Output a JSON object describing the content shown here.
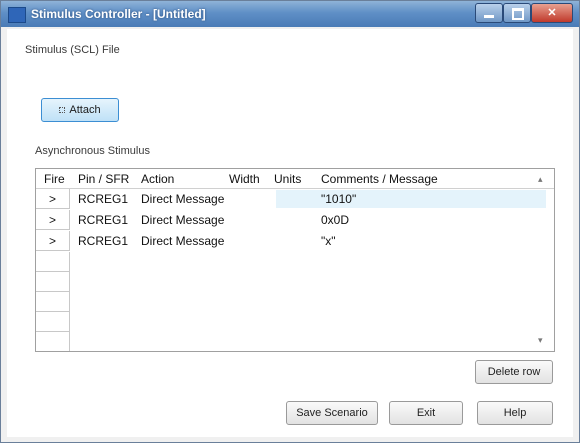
{
  "window": {
    "title": "Stimulus Controller - [Untitled]"
  },
  "stimulus_file": {
    "label": "Stimulus (SCL) File",
    "attach_label": "Attach"
  },
  "async": {
    "label": "Asynchronous Stimulus",
    "columns": [
      "Fire",
      "Pin / SFR",
      "Action",
      "Width",
      "Units",
      "Comments / Message"
    ],
    "rows": [
      {
        "fire": ">",
        "pin": "RCREG1",
        "action": "Direct Message",
        "width": "",
        "units": "",
        "comment": "\"1010\""
      },
      {
        "fire": ">",
        "pin": "RCREG1",
        "action": "Direct Message",
        "width": "",
        "units": "",
        "comment": "0x0D"
      },
      {
        "fire": ">",
        "pin": "RCREG1",
        "action": "Direct Message",
        "width": "",
        "units": "",
        "comment": "\"x\""
      }
    ]
  },
  "buttons": {
    "delete_row": "Delete row",
    "save_scenario": "Save Scenario",
    "exit": "Exit",
    "help": "Help"
  },
  "icons": {
    "app": "app-window-icon",
    "minimize": "minimize-icon",
    "maximize": "maximize-icon",
    "close": "close-icon",
    "fire": "fire-arrow-icon"
  },
  "colors": {
    "titlebar": "#5f8fc6",
    "attach_button": "#bfe1f7",
    "row_highlight": "#e4f3fb"
  }
}
